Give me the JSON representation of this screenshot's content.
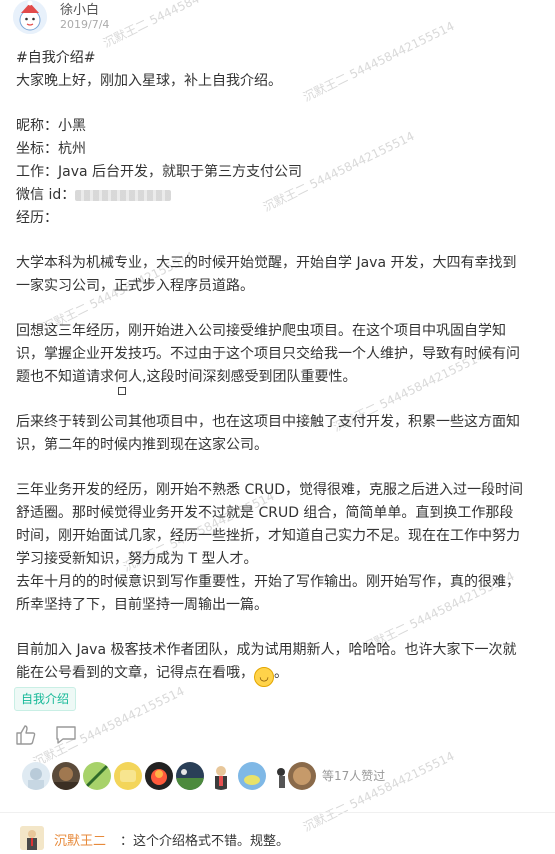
{
  "header": {
    "author": "徐小白",
    "date": "2019/7/4"
  },
  "post": {
    "title": "#自我介绍#",
    "greeting": "大家晚上好，刚加入星球，补上自我介绍。",
    "nickname": "昵称：小黑",
    "location": "坐标：杭州",
    "job": "工作：Java 后台开发，就职于第三方支付公司",
    "wechat_label": "微信 id：",
    "experience_label": "经历：",
    "para1_l1": "大学本科为机械专业，大三的时候开始觉醒，开始自学 Java 开发，大四有幸找到",
    "para1_l2": "一家实习公司，正式步入程序员道路。",
    "para2_l1": "回想这三年经历，刚开始进入公司接受维护爬虫项目。在这个项目中巩固自学知",
    "para2_l2": "识，掌握企业开发技巧。不过由于这个项目只交给我一个人维护，导致有时候有问",
    "para2_l3": "题也不知道请求何人,这段时间深刻感受到团队重要性。",
    "para3_l1": "后来终于转到公司其他项目中，也在这项目中接触了支付开发，积累一些这方面知",
    "para3_l2": "识，第二年的时候内推到现在这家公司。",
    "para4_l1": "三年业务开发的经历，刚开始不熟悉 CRUD，觉得很难，克服之后进入过一段时间",
    "para4_l2": "舒适圈。那时候觉得业务开发不过就是 CRUD 组合，简简单单。直到换工作那段",
    "para4_l3": "时间，刚开始面试几家，经历一些挫折，才知道自己实力不足。现在在工作中努力",
    "para4_l4": "学习接受新知识，努力成为 T 型人才。",
    "para4_l5": "去年十月的的时候意识到写作重要性，开始了写作输出。刚开始写作，真的很难，",
    "para4_l6": "所幸坚持了下，目前坚持一周输出一篇。",
    "para5_l1": "目前加入 Java 极客技术作者团队，成为试用期新人，哈哈哈。也许大家下一次就",
    "para5_l2": "能在公号看到的文章，记得点在看哦，"
  },
  "tag": "自我介绍",
  "likes_text": "等17人赞过",
  "comment": {
    "name": "沉默王二",
    "text": "：这个介绍格式不错。规整。"
  },
  "watermarks": [
    "沉默王二 544458442155514"
  ],
  "colors": {
    "accent_green": "#16b998",
    "comment_name": "#e78a3b",
    "meta_gray": "#aaaaaa"
  },
  "icons": [
    "like-icon",
    "comment-icon",
    "grin-emoji-icon"
  ]
}
